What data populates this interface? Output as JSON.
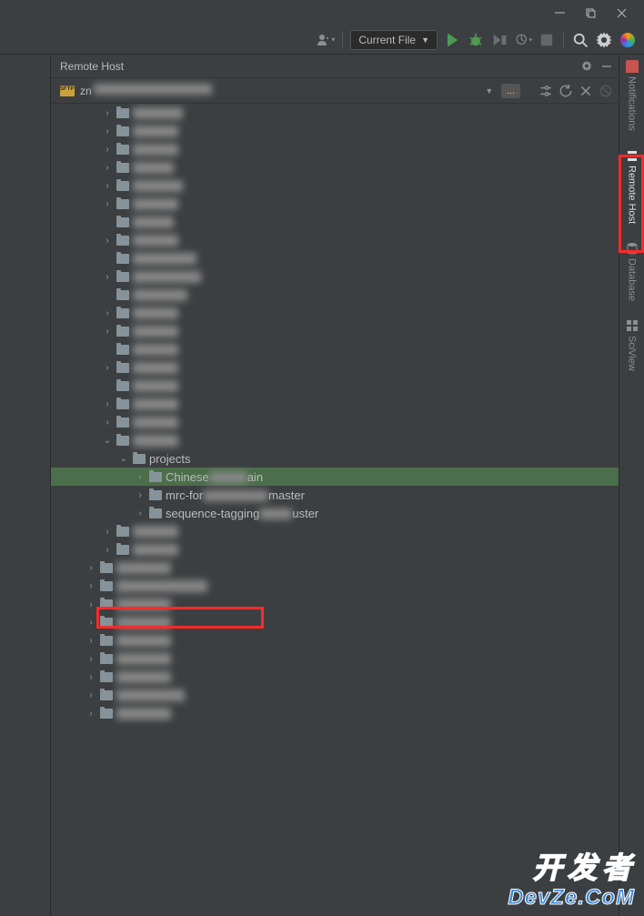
{
  "titlebar": {
    "minimize": "—",
    "maximize": "❐",
    "close": "✕"
  },
  "toolbar": {
    "runConfig": "Current File",
    "icons": [
      "user",
      "run_config",
      "play",
      "bug",
      "coverage",
      "profile",
      "stop",
      "search",
      "settings",
      "code_with_me"
    ]
  },
  "panel": {
    "title": "Remote Host",
    "gear": "⚙",
    "minimize": "—"
  },
  "host": {
    "name": "zn",
    "dropdown": "▼",
    "more": "...",
    "filter": "⇄",
    "refresh": "⟳",
    "disconnect": "✕",
    "help": "⊘"
  },
  "tree": [
    {
      "indent": 2,
      "chev": "›",
      "label": "███er",
      "blur": true
    },
    {
      "indent": 2,
      "chev": "›",
      "label": "████",
      "blur": true
    },
    {
      "indent": 2,
      "chev": "›",
      "label": "████",
      "blur": true
    },
    {
      "indent": 2,
      "chev": "›",
      "label": "███",
      "blur": true
    },
    {
      "indent": 2,
      "chev": "›",
      "label": "███ h",
      "blur": true
    },
    {
      "indent": 2,
      "chev": "›",
      "label": "████",
      "blur": true
    },
    {
      "indent": 2,
      "chev": "",
      "label": "███",
      "blur": true,
      "nochev": true
    },
    {
      "indent": 2,
      "chev": "›",
      "label": "████",
      "blur": true
    },
    {
      "indent": 2,
      "chev": "",
      "label": "████████",
      "blur": true,
      "nochev": true
    },
    {
      "indent": 2,
      "chev": "›",
      "label": "████ ████",
      "blur": true
    },
    {
      "indent": 2,
      "chev": "",
      "label": "██████",
      "blur": true,
      "nochev": true
    },
    {
      "indent": 2,
      "chev": "›",
      "label": "████",
      "blur": true
    },
    {
      "indent": 2,
      "chev": "›",
      "label": "████",
      "blur": true
    },
    {
      "indent": 2,
      "chev": "",
      "label": "██ w",
      "blur": true,
      "nochev": true
    },
    {
      "indent": 2,
      "chev": "›",
      "label": "████",
      "blur": true
    },
    {
      "indent": 2,
      "chev": "",
      "label": "████",
      "blur": true,
      "nochev": true
    },
    {
      "indent": 2,
      "chev": "›",
      "label": "████",
      "blur": true
    },
    {
      "indent": 2,
      "chev": "›",
      "label": "████",
      "blur": true
    },
    {
      "indent": 2,
      "chev": "⌄",
      "label": "████",
      "blur": true
    },
    {
      "indent": 3,
      "chev": "⌄",
      "label": "projects",
      "blur": false
    },
    {
      "indent": 4,
      "chev": "›",
      "label": "Chinese███████ain",
      "blur": false,
      "selected": true,
      "partBlur": true
    },
    {
      "indent": 4,
      "chev": "›",
      "label": "mrc-for████████████master",
      "blur": false,
      "partBlur": true
    },
    {
      "indent": 4,
      "chev": "›",
      "label": "sequence-tagging██████uster",
      "blur": false,
      "partBlur": true
    },
    {
      "indent": 2,
      "chev": "›",
      "label": "████",
      "blur": true
    },
    {
      "indent": 2,
      "chev": "›",
      "label": "████",
      "blur": true
    },
    {
      "indent": 1,
      "chev": "›",
      "label": "██████",
      "blur": true
    },
    {
      "indent": 1,
      "chev": "›",
      "label": "██████████████",
      "blur": true
    },
    {
      "indent": 1,
      "chev": "›",
      "label": "██████",
      "blur": true
    },
    {
      "indent": 1,
      "chev": "›",
      "label": "██████",
      "blur": true
    },
    {
      "indent": 1,
      "chev": "›",
      "label": "██████",
      "blur": true
    },
    {
      "indent": 1,
      "chev": "›",
      "label": "██████",
      "blur": true
    },
    {
      "indent": 1,
      "chev": "›",
      "label": "██████",
      "blur": true
    },
    {
      "indent": 1,
      "chev": "›",
      "label": "█████████",
      "blur": true
    },
    {
      "indent": 1,
      "chev": "›",
      "label": "██████",
      "blur": true
    }
  ],
  "rightTools": {
    "notifications": "Notifications",
    "remoteHost": "Remote Host",
    "database": "Database",
    "sciview": "SciView"
  },
  "watermark": {
    "cn": "开发者",
    "en": "DevZe.CoM"
  }
}
